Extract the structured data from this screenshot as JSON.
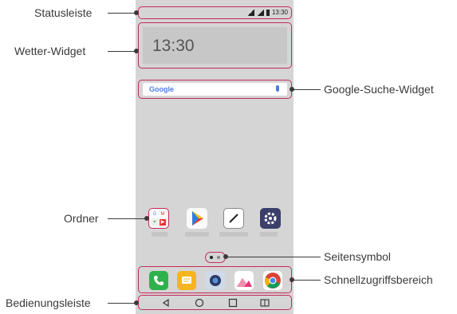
{
  "labels": {
    "statusbar": "Statusleiste",
    "weather_widget": "Wetter-Widget",
    "google_widget": "Google-Suche-Widget",
    "folder": "Ordner",
    "page_icon": "Seitensymbol",
    "quick_access": "Schnellzugriffsbereich",
    "nav_bar": "Bedienungsleiste"
  },
  "phone": {
    "status_time": "13:30",
    "clock_time": "13:30",
    "search_logo": "Google",
    "page_indicator": {
      "count": 2,
      "active_index": 0
    }
  },
  "colors": {
    "callout_accent": "#c42a5a",
    "screen_bg": "#d5d5d5",
    "phone_app": "#2fb24c",
    "messages_app": "#f5b51e",
    "camera_app": "#5a8fd8"
  },
  "icons": {
    "home_apps": [
      "folder-icon",
      "play-store-icon",
      "pen-icon",
      "settings-gear-icon"
    ],
    "quick_apps": [
      "phone-icon",
      "messages-icon",
      "camera-icon",
      "gallery-icon",
      "chrome-icon"
    ],
    "nav_buttons": [
      "back-icon",
      "home-icon",
      "recent-apps-icon",
      "dual-window-icon"
    ]
  }
}
